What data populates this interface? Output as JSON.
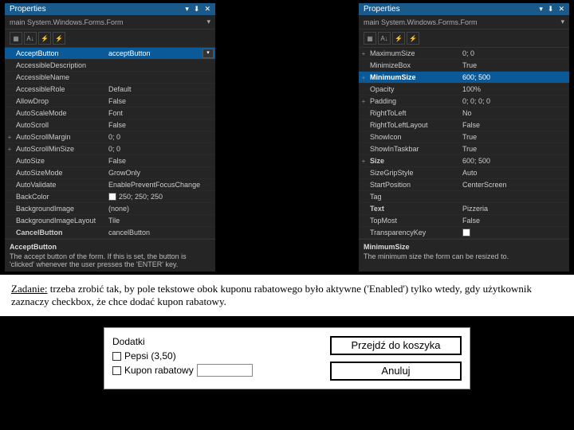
{
  "leftPanel": {
    "title": "Properties",
    "subtitle": "main System.Windows.Forms.Form",
    "rows": [
      {
        "k": "AcceptButton",
        "v": "acceptButton",
        "sel": true,
        "dd": true
      },
      {
        "k": "AccessibleDescription",
        "v": ""
      },
      {
        "k": "AccessibleName",
        "v": ""
      },
      {
        "k": "AccessibleRole",
        "v": "Default"
      },
      {
        "k": "AllowDrop",
        "v": "False"
      },
      {
        "k": "AutoScaleMode",
        "v": "Font"
      },
      {
        "k": "AutoScroll",
        "v": "False"
      },
      {
        "k": "AutoScrollMargin",
        "v": "0; 0",
        "exp": "+"
      },
      {
        "k": "AutoScrollMinSize",
        "v": "0; 0",
        "exp": "+"
      },
      {
        "k": "AutoSize",
        "v": "False"
      },
      {
        "k": "AutoSizeMode",
        "v": "GrowOnly"
      },
      {
        "k": "AutoValidate",
        "v": "EnablePreventFocusChange"
      },
      {
        "k": "BackColor",
        "v": "250; 250; 250",
        "swatch": true
      },
      {
        "k": "BackgroundImage",
        "v": "(none)"
      },
      {
        "k": "BackgroundImageLayout",
        "v": "Tile"
      },
      {
        "k": "CancelButton",
        "v": "cancelButton",
        "bold": true
      }
    ],
    "descTitle": "AcceptButton",
    "descText": "The accept button of the form. If this is set, the button is 'clicked' whenever the user presses the 'ENTER' key."
  },
  "rightPanel": {
    "title": "Properties",
    "subtitle": "main System.Windows.Forms.Form",
    "rows": [
      {
        "k": "MaximumSize",
        "v": "0; 0",
        "exp": "+"
      },
      {
        "k": "MinimizeBox",
        "v": "True"
      },
      {
        "k": "MinimumSize",
        "v": "600; 500",
        "exp": "+",
        "sel": true,
        "bold": true
      },
      {
        "k": "Opacity",
        "v": "100%"
      },
      {
        "k": "Padding",
        "v": "0; 0; 0; 0",
        "exp": "+"
      },
      {
        "k": "RightToLeft",
        "v": "No"
      },
      {
        "k": "RightToLeftLayout",
        "v": "False"
      },
      {
        "k": "ShowIcon",
        "v": "True"
      },
      {
        "k": "ShowInTaskbar",
        "v": "True"
      },
      {
        "k": "Size",
        "v": "600; 500",
        "exp": "+",
        "bold": true
      },
      {
        "k": "SizeGripStyle",
        "v": "Auto"
      },
      {
        "k": "StartPosition",
        "v": "CenterScreen"
      },
      {
        "k": "Tag",
        "v": ""
      },
      {
        "k": "Text",
        "v": "Pizzeria",
        "bold": true
      },
      {
        "k": "TopMost",
        "v": "False"
      },
      {
        "k": "TransparencyKey",
        "v": "",
        "emptysw": true
      }
    ],
    "descTitle": "MinimumSize",
    "descText": "The minimum size the form can be resized to."
  },
  "task": {
    "label": "Zadanie:",
    "text": " trzeba zrobić tak, by pole tekstowe obok kuponu rabatowego było aktywne ('Enabled') tylko wtedy, gdy użytkownik zaznaczy checkbox, że chce dodać kupon rabatowy."
  },
  "form": {
    "legend": "Dodatki",
    "cb1": "Pepsi (3,50)",
    "cb2": "Kupon rabatowy",
    "btn1": "Przejdź do koszyka",
    "btn2": "Anuluj"
  }
}
